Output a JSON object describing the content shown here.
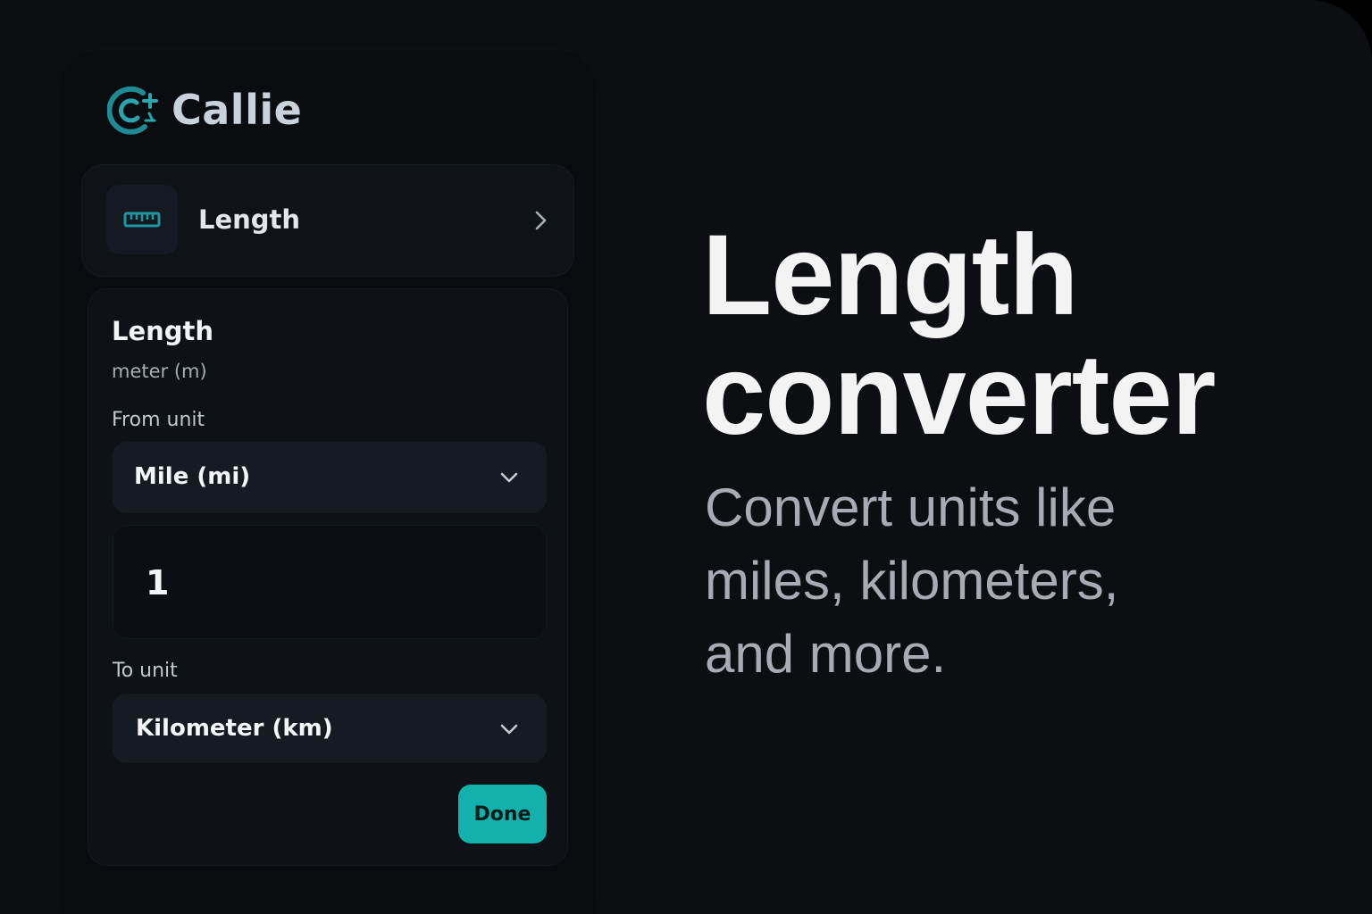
{
  "brand": {
    "name": "Callie",
    "accent_color": "#1e8a93"
  },
  "category": {
    "icon": "ruler-icon",
    "label": "Length"
  },
  "card": {
    "title": "Length",
    "subtitle": "meter (m)",
    "from_label": "From unit",
    "from_value": "Mile (mi)",
    "input_value": "1",
    "to_label": "To unit",
    "to_value": "Kilometer (km)",
    "done_label": "Done"
  },
  "hero": {
    "title": "Length converter",
    "subtitle": "Convert units like miles, kilometers, and more."
  },
  "colors": {
    "background": "#0c0e12",
    "button": "#12b1ab",
    "muted_text": "#a8abb3"
  }
}
